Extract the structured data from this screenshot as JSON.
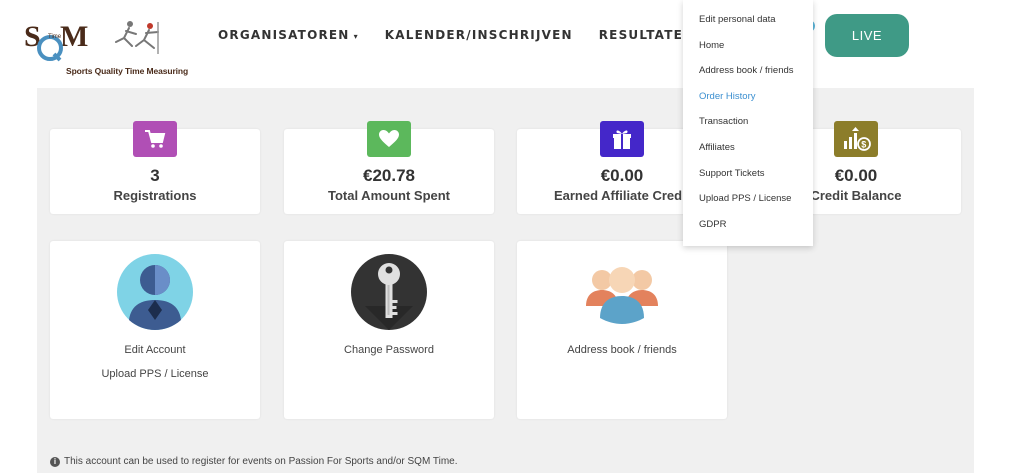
{
  "logo": {
    "letters": "SQM",
    "small": "Time",
    "tagline": "Sports Quality Time Measuring"
  },
  "nav": {
    "items": [
      {
        "label": "ORGANISATOREN",
        "has_caret": true
      },
      {
        "label": "KALENDER/INSCHRIJVEN"
      },
      {
        "label": "RESULTATEN"
      }
    ],
    "caret": "▾",
    "live_label": "LIVE"
  },
  "stats": [
    {
      "value": "3",
      "label": "Registrations",
      "color": "#b04fb5",
      "icon": "cart-icon"
    },
    {
      "value": "€20.78",
      "label": "Total Amount Spent",
      "color": "#5cb85c",
      "icon": "heart-icon"
    },
    {
      "value": "€0.00",
      "label": "Earned Affiliate Credit",
      "color": "#4427c9",
      "icon": "gift-icon"
    },
    {
      "value": "€0.00",
      "label": "Credit Balance",
      "color": "#8c7d2a",
      "icon": "growth-icon"
    }
  ],
  "actions": {
    "account": {
      "line1": "Edit Account",
      "line2": "Upload PPS / License"
    },
    "password": {
      "line1": "Change Password"
    },
    "address": {
      "line1": "Address book / friends"
    }
  },
  "footer": {
    "info": "i",
    "note": "This account can be used to register for events on Passion For Sports and/or SQM Time."
  },
  "dropdown": {
    "items": [
      {
        "label": "Edit personal data"
      },
      {
        "label": "Home"
      },
      {
        "label": "Address book / friends"
      },
      {
        "label": "Order History",
        "active": true
      },
      {
        "label": "Transaction"
      },
      {
        "label": "Affiliates"
      },
      {
        "label": "Support Tickets"
      },
      {
        "label": "Upload PPS / License"
      },
      {
        "label": "GDPR"
      }
    ]
  }
}
